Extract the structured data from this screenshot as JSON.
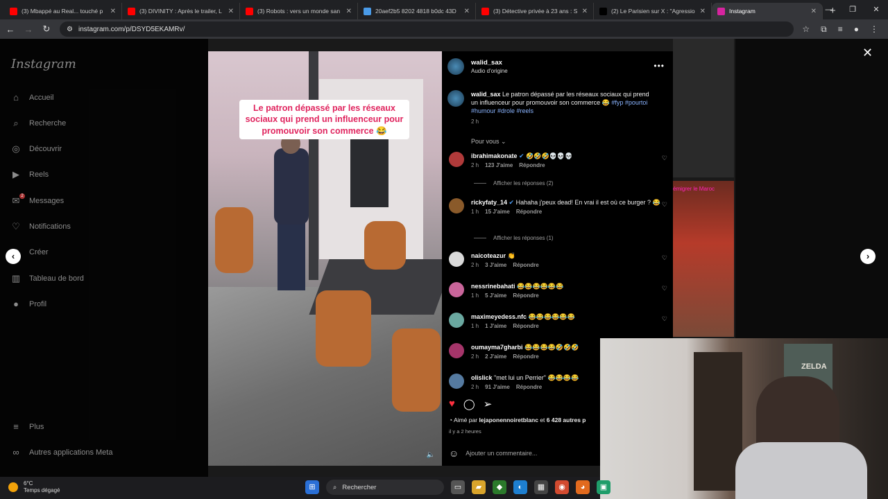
{
  "browser": {
    "tabs": [
      {
        "title": "(3) Mbappé au Real... touché p",
        "fav_color": "#ff0000"
      },
      {
        "title": "(3) DIVINITY : Après le trailer, L",
        "fav_color": "#ff0000"
      },
      {
        "title": "(3) Robots : vers un monde san",
        "fav_color": "#ff0000"
      },
      {
        "title": "20aef2b5 8202 4818 b0dc 43D",
        "fav_color": "#4a9be8"
      },
      {
        "title": "(3) Détective privée à 23 ans : S",
        "fav_color": "#ff0000"
      },
      {
        "title": "(2) Le Parisien sur X : \"Agressio",
        "fav_color": "#000000"
      },
      {
        "title": "Instagram",
        "fav_color": "#d6249f",
        "active": true
      }
    ],
    "url": "instagram.com/p/DSYD5EKAMRv/"
  },
  "sidebar": {
    "logo": "Instagram",
    "items": [
      {
        "label": "Accueil",
        "icon": "home-icon"
      },
      {
        "label": "Recherche",
        "icon": "search-icon"
      },
      {
        "label": "Découvrir",
        "icon": "compass-icon"
      },
      {
        "label": "Reels",
        "icon": "reels-icon"
      },
      {
        "label": "Messages",
        "icon": "messenger-icon",
        "badge": "2"
      },
      {
        "label": "Notifications",
        "icon": "heart-icon"
      },
      {
        "label": "Créer",
        "icon": "plus-icon"
      },
      {
        "label": "Tableau de bord",
        "icon": "dashboard-icon"
      },
      {
        "label": "Profil",
        "icon": "profile-icon"
      },
      {
        "label": "Plus",
        "icon": "menu-icon"
      },
      {
        "label": "Autres applications Meta",
        "icon": "meta-icon"
      }
    ]
  },
  "video": {
    "caption": "Le patron dépassé par les réseaux sociaux qui prend un influenceur pour promouvoir son commerce 😂"
  },
  "background": {
    "card_label": "émigrer le Maroc"
  },
  "post": {
    "author": "walid_sax",
    "audio": "Audio d'origine",
    "caption_text": "Le patron dépassé par les réseaux sociaux qui prend un influenceur pour promouvoir son commerce 😂",
    "hashtags": "#fyp #pourtoi #humour #drole #reels",
    "caption_time": "2 h",
    "sort": "Pour vous",
    "comments": [
      {
        "user": "ibrahimakonate",
        "verified": true,
        "text": "🤣🤣🤣💀💀💀",
        "time": "2 h",
        "likes": "123 J'aime",
        "reply": "Répondre",
        "replies": "Afficher les réponses (2)",
        "avatar_color": "#b03a3a"
      },
      {
        "user": "rickyfaty_14",
        "verified": true,
        "text": "Hahaha j'peux dead! En vrai il est où ce burger ? 😂",
        "time": "1 h",
        "likes": "15 J'aime",
        "reply": "Répondre",
        "replies": "Afficher les réponses (1)",
        "avatar_color": "#8a5a2a"
      },
      {
        "user": "naicoteazur",
        "verified": false,
        "text": "👏",
        "time": "2 h",
        "likes": "3 J'aime",
        "reply": "Répondre",
        "avatar_color": "#d9d9d9"
      },
      {
        "user": "nessrinebahati",
        "verified": false,
        "text": "😂😂😂😂😂😂",
        "time": "1 h",
        "likes": "5 J'aime",
        "reply": "Répondre",
        "avatar_color": "#c9659a"
      },
      {
        "user": "maximeyedess.nfc",
        "verified": false,
        "text": "😂😂😂😂😂😂",
        "time": "1 h",
        "likes": "1 J'aime",
        "reply": "Répondre",
        "avatar_color": "#6aa8a0"
      },
      {
        "user": "oumayma7gharbi",
        "verified": false,
        "text": "😂😂😂😂🤣🤣🤣",
        "time": "2 h",
        "likes": "2 J'aime",
        "reply": "Répondre",
        "avatar_color": "#a5356a"
      },
      {
        "user": "olislick",
        "verified": false,
        "text": "\"met lui un Perrier\" 😂😂😂😂",
        "time": "2 h",
        "likes": "91 J'aime",
        "reply": "Répondre",
        "avatar_color": "#557aa0"
      }
    ],
    "liked_by_prefix": "Aimé par",
    "liked_by_user": "lejaponennoiretblanc",
    "liked_by_suffix": "et",
    "liked_by_count": "6 428 autres p",
    "ago": "il y a 2 heures",
    "add_comment_placeholder": "Ajouter un commentaire..."
  },
  "webcam": {
    "label": "ZELDA"
  },
  "taskbar": {
    "temp": "6°C",
    "weather": "Temps dégagé",
    "search": "Rechercher"
  },
  "colors": {
    "like_red": "#ff3040",
    "hashtag_blue": "#8ab4ff"
  }
}
